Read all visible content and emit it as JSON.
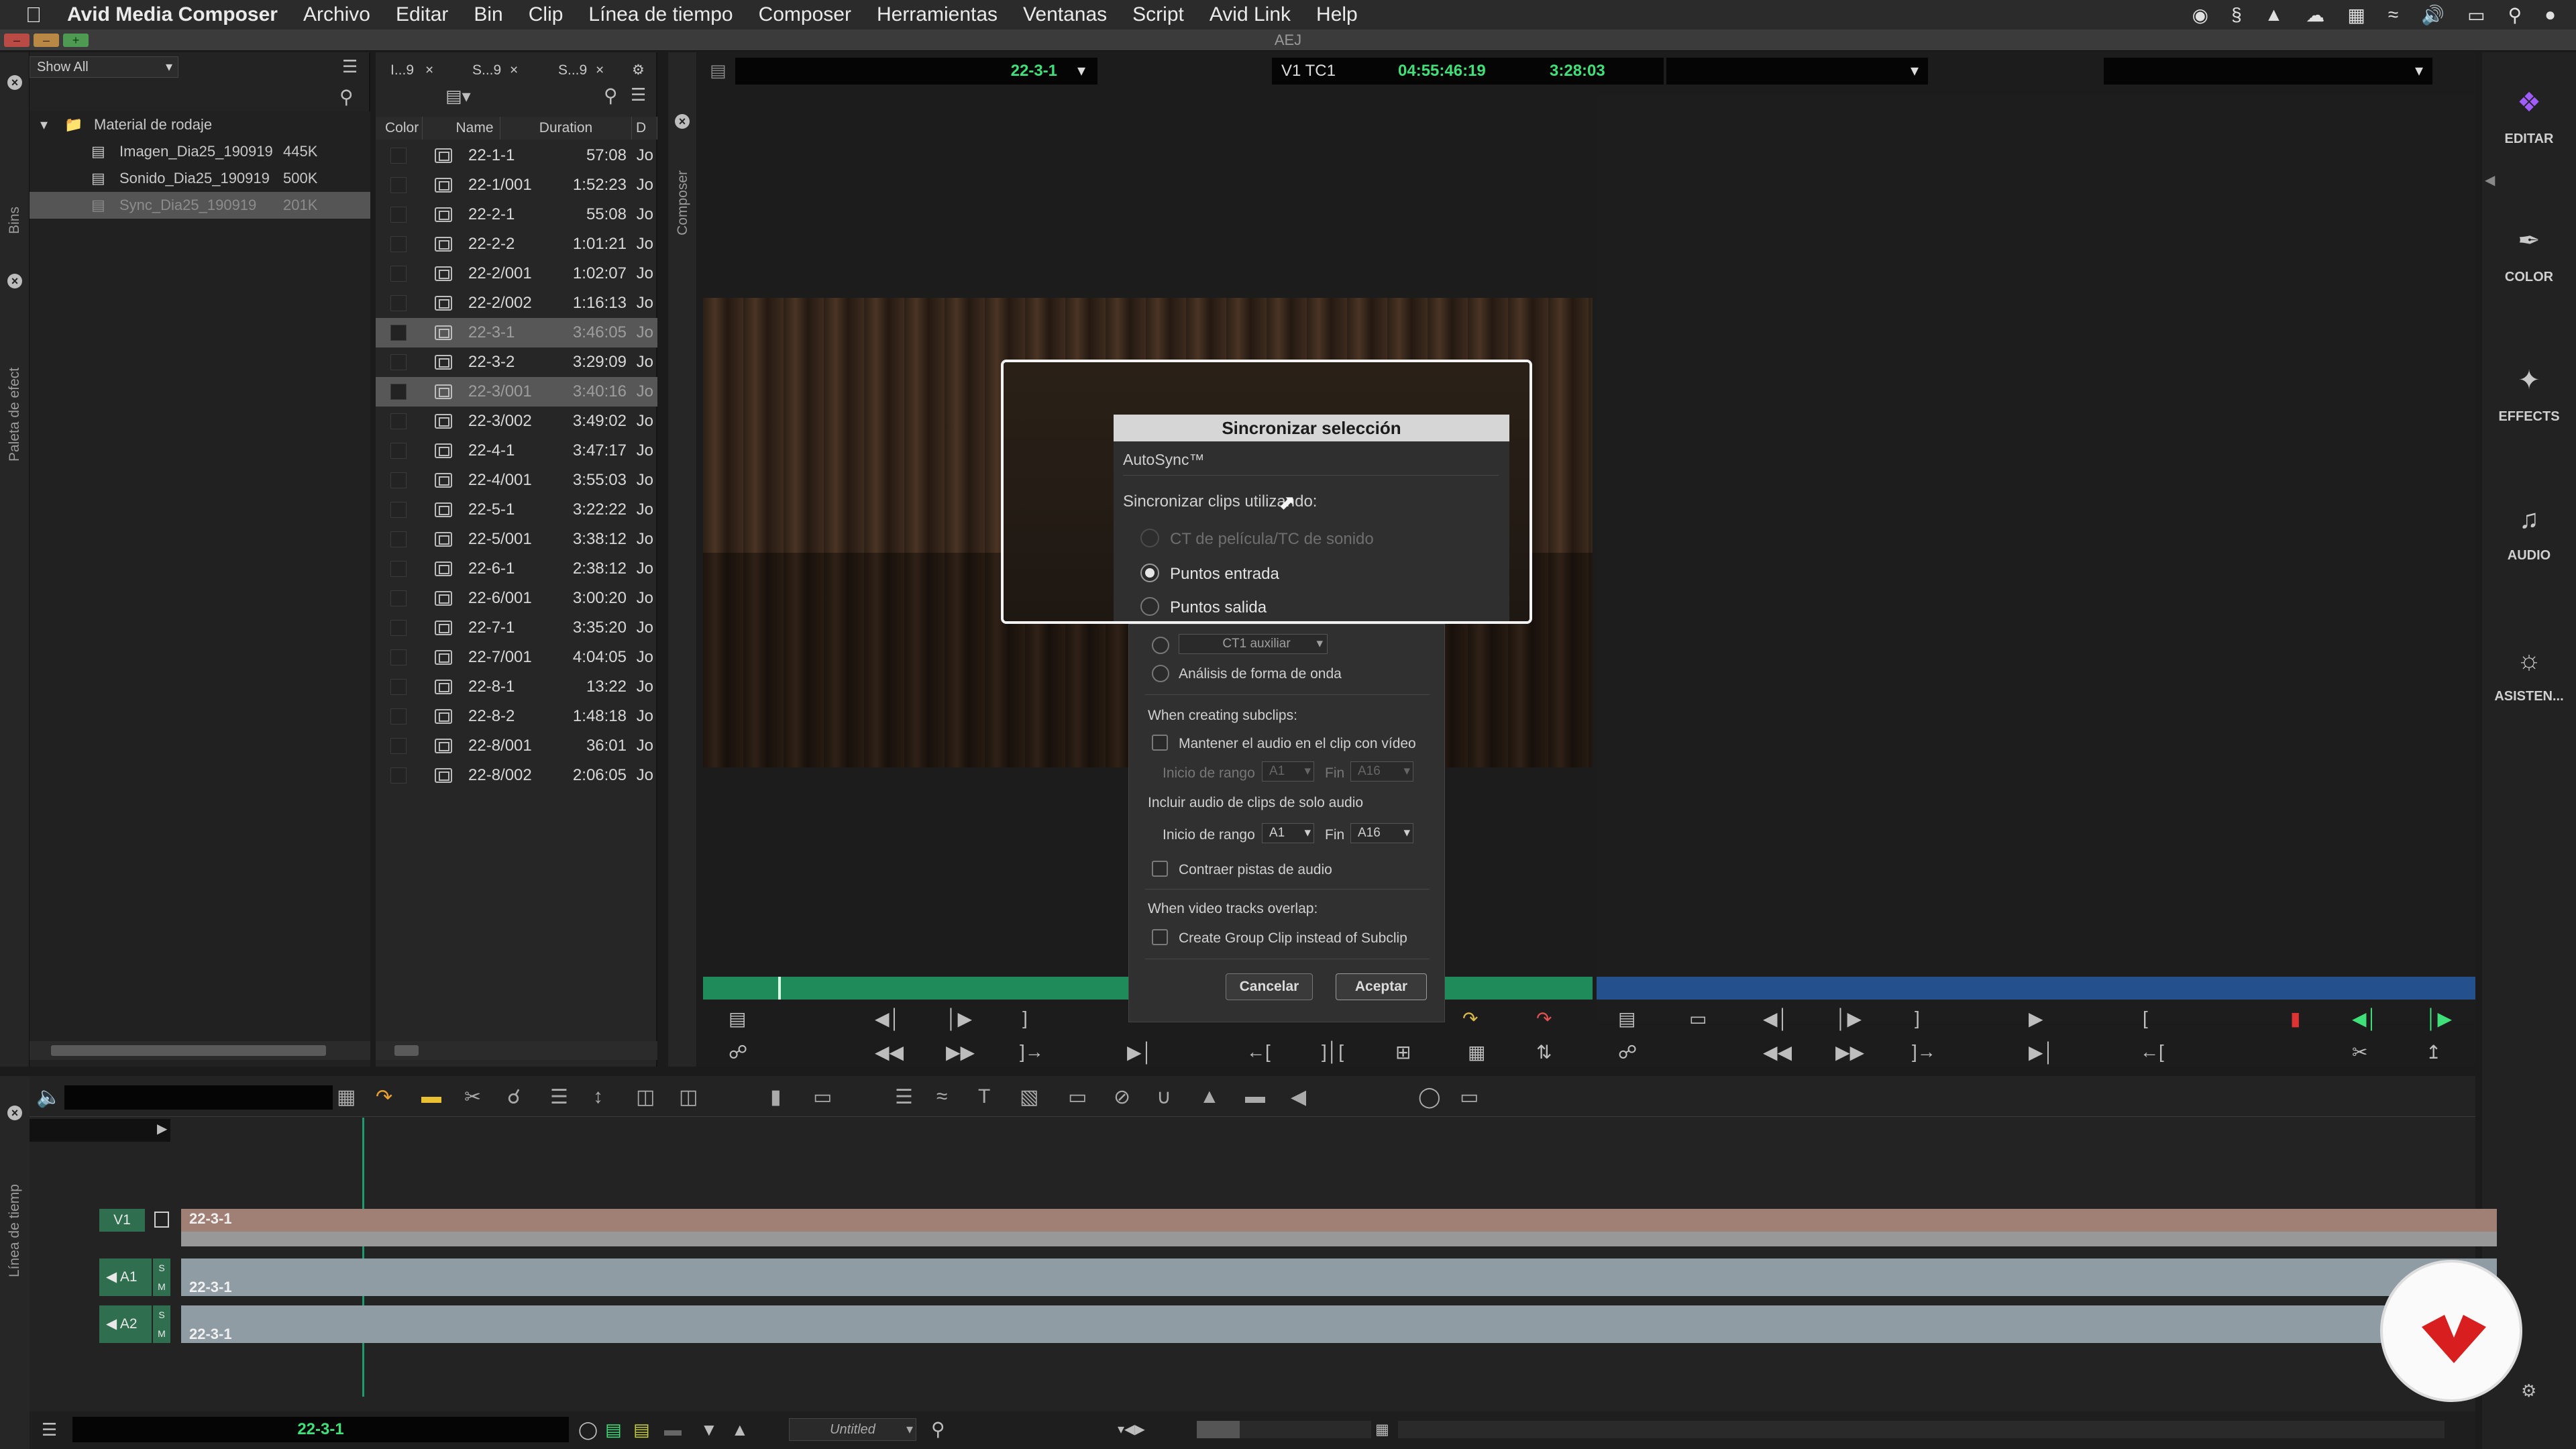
{
  "menubar": {
    "apple": "",
    "items": [
      "Avid Media Composer",
      "Archivo",
      "Editar",
      "Bin",
      "Clip",
      "Línea de tiempo",
      "Composer",
      "Herramientas",
      "Ventanas",
      "Script",
      "Avid Link",
      "Help"
    ],
    "status_icons": [
      "record-icon",
      "s-icon",
      "upload-icon",
      "cloud-icon",
      "grid-icon",
      "wifi-icon",
      "volume-icon",
      "airplay-icon",
      "search-icon",
      "siri-icon"
    ]
  },
  "titlebar": {
    "title": "AEJ",
    "min": "–",
    "close": "–",
    "add": "+"
  },
  "left_strip": {
    "bins_label": "Bins",
    "palette_label": "Paleta de efect"
  },
  "bins": {
    "filter": "Show All",
    "tree": [
      {
        "label": "Material de rodaje",
        "size": ""
      },
      {
        "label": "Imagen_Dia25_190919",
        "size": "445K"
      },
      {
        "label": "Sonido_Dia25_190919",
        "size": "500K"
      },
      {
        "label": "Sync_Dia25_190919",
        "size": "201K"
      }
    ]
  },
  "binlist": {
    "tabs": [
      "I...9",
      "S...9",
      "S...9"
    ],
    "columns": [
      "Color",
      "Name",
      "Duration",
      "D"
    ],
    "rows": [
      {
        "name": "22-1-1",
        "duration": "57:08",
        "drive": "Jo",
        "selected": false
      },
      {
        "name": "22-1/001",
        "duration": "1:52:23",
        "drive": "Jo",
        "selected": false
      },
      {
        "name": "22-2-1",
        "duration": "55:08",
        "drive": "Jo",
        "selected": false
      },
      {
        "name": "22-2-2",
        "duration": "1:01:21",
        "drive": "Jo",
        "selected": false
      },
      {
        "name": "22-2/001",
        "duration": "1:02:07",
        "drive": "Jo",
        "selected": false
      },
      {
        "name": "22-2/002",
        "duration": "1:16:13",
        "drive": "Jo",
        "selected": false
      },
      {
        "name": "22-3-1",
        "duration": "3:46:05",
        "drive": "Jo",
        "selected": true
      },
      {
        "name": "22-3-2",
        "duration": "3:29:09",
        "drive": "Jo",
        "selected": false
      },
      {
        "name": "22-3/001",
        "duration": "3:40:16",
        "drive": "Jo",
        "selected": true
      },
      {
        "name": "22-3/002",
        "duration": "3:49:02",
        "drive": "Jo",
        "selected": false
      },
      {
        "name": "22-4-1",
        "duration": "3:47:17",
        "drive": "Jo",
        "selected": false
      },
      {
        "name": "22-4/001",
        "duration": "3:55:03",
        "drive": "Jo",
        "selected": false
      },
      {
        "name": "22-5-1",
        "duration": "3:22:22",
        "drive": "Jo",
        "selected": false
      },
      {
        "name": "22-5/001",
        "duration": "3:38:12",
        "drive": "Jo",
        "selected": false
      },
      {
        "name": "22-6-1",
        "duration": "2:38:12",
        "drive": "Jo",
        "selected": false
      },
      {
        "name": "22-6/001",
        "duration": "3:00:20",
        "drive": "Jo",
        "selected": false
      },
      {
        "name": "22-7-1",
        "duration": "3:35:20",
        "drive": "Jo",
        "selected": false
      },
      {
        "name": "22-7/001",
        "duration": "4:04:05",
        "drive": "Jo",
        "selected": false
      },
      {
        "name": "22-8-1",
        "duration": "13:22",
        "drive": "Jo",
        "selected": false
      },
      {
        "name": "22-8-2",
        "duration": "1:48:18",
        "drive": "Jo",
        "selected": false
      },
      {
        "name": "22-8/001",
        "duration": "36:01",
        "drive": "Jo",
        "selected": false
      },
      {
        "name": "22-8/002",
        "duration": "2:06:05",
        "drive": "Jo",
        "selected": false
      }
    ]
  },
  "composer": {
    "label": "Composer",
    "source_clip": "22-3-1",
    "track_tc": "V1  TC1",
    "tc_value": "04:55:46:19",
    "duration": "3:28:03"
  },
  "dialog": {
    "title": "Sincronizar selección",
    "autosync": "AutoSync™",
    "sync_using": "Sincronizar clips utilizando:",
    "opt_film_tc": "CT de película/TC de sonido",
    "opt_in_points": "Puntos entrada",
    "opt_out_points": "Puntos salida",
    "opt_aux_tc": "CT1 auxiliar",
    "opt_waveform": "Análisis de forma de onda",
    "when_subclips": "When creating subclips:",
    "keep_audio": "Mantener el audio en el clip con vídeo",
    "range_start": "Inicio de rango",
    "range_a1": "A1",
    "range_end": "Fin",
    "range_a16": "A16",
    "include_audio": "Incluir audio de clips de solo audio",
    "range_start2": "Inicio de rango",
    "range_a1_2": "A1",
    "range_end2": "Fin",
    "range_a16_2": "A16",
    "collapse_audio": "Contraer pistas de audio",
    "when_overlap": "When video tracks overlap:",
    "group_clip": "Create Group Clip instead of Subclip",
    "cancel": "Cancelar",
    "accept": "Aceptar"
  },
  "workspaces": [
    {
      "label": "EDITAR",
      "icon": "edit-icon"
    },
    {
      "label": "COLOR",
      "icon": "color-icon"
    },
    {
      "label": "EFFECTS",
      "icon": "effects-icon"
    },
    {
      "label": "AUDIO",
      "icon": "audio-icon"
    },
    {
      "label": "ASISTEN...",
      "icon": "assistant-icon"
    }
  ],
  "timeline": {
    "label": "Línea de tiemp",
    "tracks": [
      {
        "name": "V1",
        "clip": "22-3-1",
        "color": "#a08074"
      },
      {
        "name": "A1",
        "clip": "22-3-1",
        "color": "#8f9ca3"
      },
      {
        "name": "A2",
        "clip": "22-3-1",
        "color": "#8f9ca3"
      }
    ],
    "sequence_name": "22-3-1",
    "untitled": "Untitled"
  },
  "colors": {
    "accent_green": "#3fe07a",
    "track_green": "#2f6f4f",
    "brand_red": "#d81e1e"
  }
}
